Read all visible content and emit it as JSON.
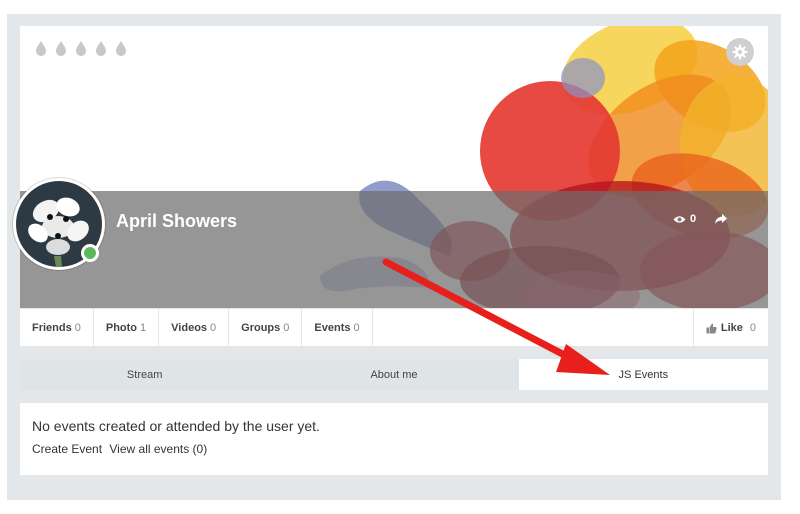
{
  "profile": {
    "name": "April Showers",
    "views": "0",
    "online_color": "#5cb85c"
  },
  "cover": {
    "drops": [
      "water-drop-icon",
      "water-drop-icon",
      "water-drop-icon",
      "water-drop-icon",
      "water-drop-icon"
    ],
    "accent_colors": [
      "#e53a33",
      "#f4a21a",
      "#c20e1a",
      "#8a93c9",
      "#f6d24b"
    ]
  },
  "stats": [
    {
      "label": "Friends",
      "count": "0"
    },
    {
      "label": "Photo",
      "count": "1"
    },
    {
      "label": "Videos",
      "count": "0"
    },
    {
      "label": "Groups",
      "count": "0"
    },
    {
      "label": "Events",
      "count": "0"
    }
  ],
  "like": {
    "label": "Like",
    "count": "0"
  },
  "tabs": [
    {
      "label": "Stream",
      "active": false
    },
    {
      "label": "About me",
      "active": false
    },
    {
      "label": "JS Events",
      "active": true
    }
  ],
  "events_panel": {
    "empty_message": "No events created or attended by the user yet.",
    "create_link": "Create Event",
    "view_all_link": "View all events (0)"
  },
  "annotation": {
    "arrow_color": "#e8201c"
  }
}
